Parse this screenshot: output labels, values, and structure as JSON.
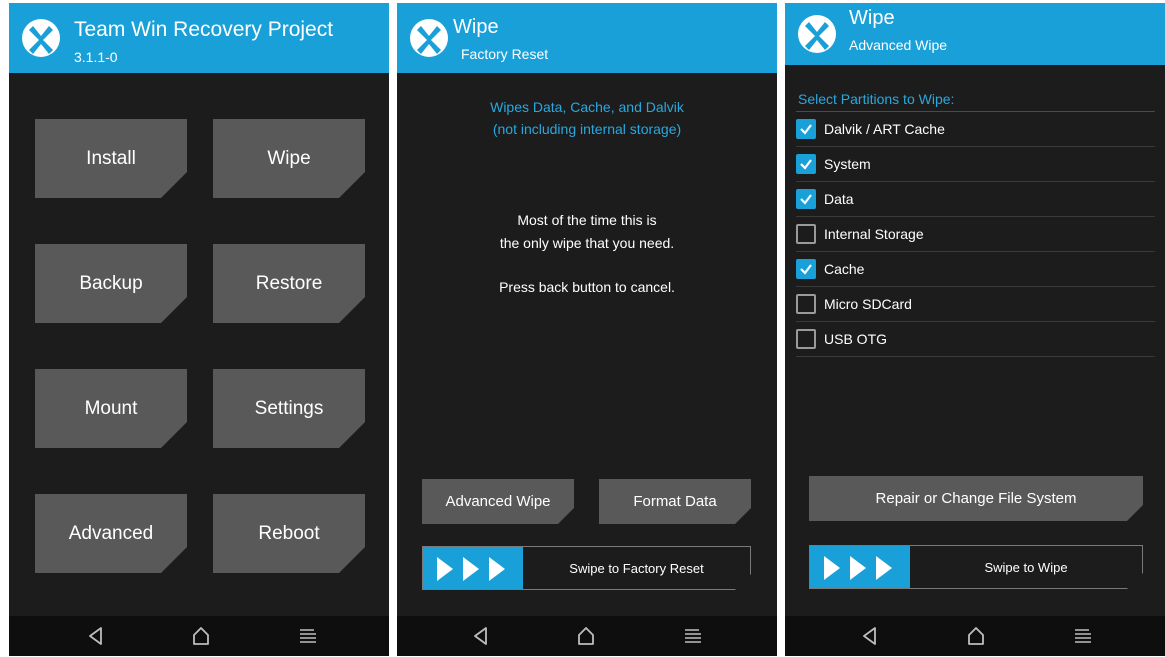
{
  "screen1": {
    "title": "Team Win Recovery Project",
    "version": "3.1.1-0",
    "buttons": [
      "Install",
      "Wipe",
      "Backup",
      "Restore",
      "Mount",
      "Settings",
      "Advanced",
      "Reboot"
    ]
  },
  "screen2": {
    "title": "Wipe",
    "subtitle": "Factory Reset",
    "info_line1": "Wipes Data, Cache, and Dalvik",
    "info_line2": "(not including internal storage)",
    "body_line1": "Most of the time this is",
    "body_line2": "the only wipe that you need.",
    "body_line3": "Press back button to cancel.",
    "advanced_wipe": "Advanced Wipe",
    "format_data": "Format Data",
    "swipe_label": "Swipe to Factory Reset"
  },
  "screen3": {
    "title": "Wipe",
    "subtitle": "Advanced Wipe",
    "select_title": "Select Partitions to Wipe:",
    "partitions": [
      {
        "label": "Dalvik / ART Cache",
        "checked": true
      },
      {
        "label": "System",
        "checked": true
      },
      {
        "label": "Data",
        "checked": true
      },
      {
        "label": "Internal Storage",
        "checked": false
      },
      {
        "label": "Cache",
        "checked": true
      },
      {
        "label": "Micro SDCard",
        "checked": false
      },
      {
        "label": "USB OTG",
        "checked": false
      }
    ],
    "repair_button": "Repair or Change File System",
    "swipe_label": "Swipe to Wipe"
  },
  "colors": {
    "accent": "#1aa0d8",
    "tile": "#595959",
    "background": "#1c1c1c",
    "navbar": "#0e0e0e"
  },
  "icons": {
    "logo": "twrp-logo-icon",
    "back": "back-triangle-icon",
    "home": "home-icon",
    "menu": "menu-lines-icon"
  }
}
